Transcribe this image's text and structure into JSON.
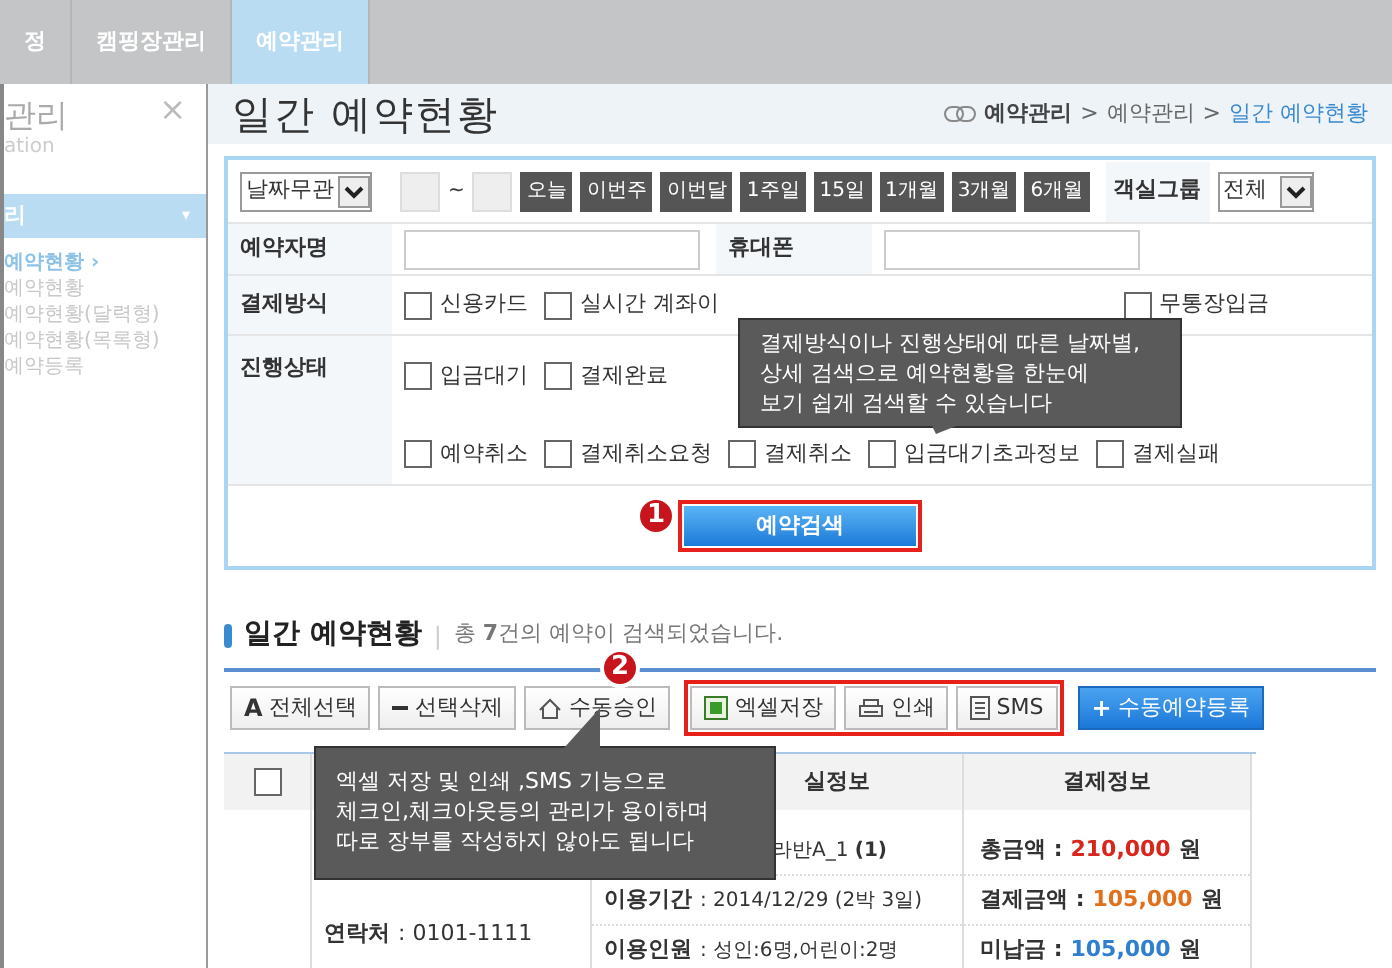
{
  "top_nav": [
    {
      "label": "정",
      "selected": false
    },
    {
      "label": "캠핑장관리",
      "selected": false
    },
    {
      "label": "예약관리",
      "selected": true
    }
  ],
  "sidebar": {
    "title": "관리",
    "subtitle": "ation",
    "close": "×",
    "section": "리",
    "section_caret": "▾",
    "items": [
      {
        "label": "예약현황 ›",
        "selected": true
      },
      {
        "label": "예약현황",
        "selected": false
      },
      {
        "label": "예약현황(달력형)",
        "selected": false
      },
      {
        "label": "예약현황(목록형)",
        "selected": false
      },
      {
        "label": "예약등록",
        "selected": false
      }
    ]
  },
  "page_title": "일간 예약현황",
  "breadcrumb": {
    "items": [
      {
        "label": "예약관리",
        "kind": "root"
      },
      {
        "label": ">",
        "kind": "sep"
      },
      {
        "label": "예약관리",
        "kind": "link"
      },
      {
        "label": ">",
        "kind": "sep"
      },
      {
        "label": "일간 예약현황",
        "kind": "current"
      }
    ]
  },
  "search": {
    "date_select": "날짜무관",
    "range_sep": "~",
    "period_buttons": [
      "오늘",
      "이번주",
      "이번달",
      "1주일",
      "15일",
      "1개월",
      "3개월",
      "6개월"
    ],
    "room_group_label": "객실그룹",
    "room_group_select": "전체",
    "name_label": "예약자명",
    "phone_label": "휴대폰",
    "payment_label": "결제방식",
    "payment_options": [
      {
        "label": "신용카드",
        "checked": false
      },
      {
        "label": "실시간 계좌이",
        "checked": false
      },
      {
        "label": "무통장입금",
        "checked": false
      }
    ],
    "status_label": "진행상태",
    "status_rows": [
      [
        {
          "label": "입금대기",
          "checked": false
        },
        {
          "label": "결제완료",
          "checked": false
        }
      ],
      [
        {
          "label": "예약취소",
          "checked": false
        },
        {
          "label": "결제취소요청",
          "checked": false
        },
        {
          "label": "결제취소",
          "checked": false
        },
        {
          "label": "입금대기초과정보",
          "checked": false
        },
        {
          "label": "결제실패",
          "checked": false
        }
      ]
    ],
    "search_button": "예약검색"
  },
  "results": {
    "title": "일간 예약현황",
    "divider": "|",
    "summary": "총 **7**건의 예약이 검색되었습니다.",
    "toolbar": [
      {
        "highlighted": false,
        "buttons": [
          {
            "label": "전체선택",
            "prefix": "A",
            "kind": "select-all"
          },
          {
            "label": "선택삭제",
            "kind": "delete"
          },
          {
            "label": "수동승인",
            "kind": "approve"
          }
        ]
      },
      {
        "highlighted": true,
        "buttons": [
          {
            "label": "엑셀저장",
            "kind": "excel"
          },
          {
            "label": "인쇄",
            "kind": "print"
          },
          {
            "label": "SMS",
            "kind": "sms"
          }
        ]
      },
      {
        "highlighted": false,
        "buttons": [
          {
            "label": "수동예약등록",
            "prefix": "+",
            "kind": "add"
          }
        ]
      }
    ]
  },
  "table": {
    "header_checkbox": {
      "checked": false
    },
    "columns": [
      "실정보",
      "결제정보"
    ],
    "rows": [
      {
        "customer": [
          {
            "label": "연락처",
            "value": ": 0101-1111"
          }
        ],
        "room": [
          {
            "value": "라반A_1 **(1)**"
          },
          {
            "label": "이용기간",
            "value": ": 2014/12/29 (2박 3일)"
          },
          {
            "label": "이용인원",
            "value": ": 성인:6명,어린이:2명"
          }
        ],
        "payment": [
          {
            "label": "총금액 :",
            "amount": "210,000",
            "unit": "원",
            "color": "#d9261c"
          },
          {
            "label": "결제금액 :",
            "amount": "105,000",
            "unit": "원",
            "color": "#e0701c"
          },
          {
            "label": "미납금 :",
            "amount": "105,000",
            "unit": "원",
            "color": "#2f7fd0"
          }
        ]
      }
    ]
  },
  "callouts": [
    {
      "marker": "1",
      "text": "결제방식이나 진행상태에 따른 날짜별,\n상세 검색으로 예약현황을 한눈에\n보기 쉽게 검색할 수 있습니다"
    },
    {
      "marker": "2",
      "text": "엑셀 저장 및 인쇄 ,SMS 기능으로\n체크인,체크아웃등의 관리가 용이하며\n따로 장부를 작성하지 않아도 됩니다"
    }
  ]
}
